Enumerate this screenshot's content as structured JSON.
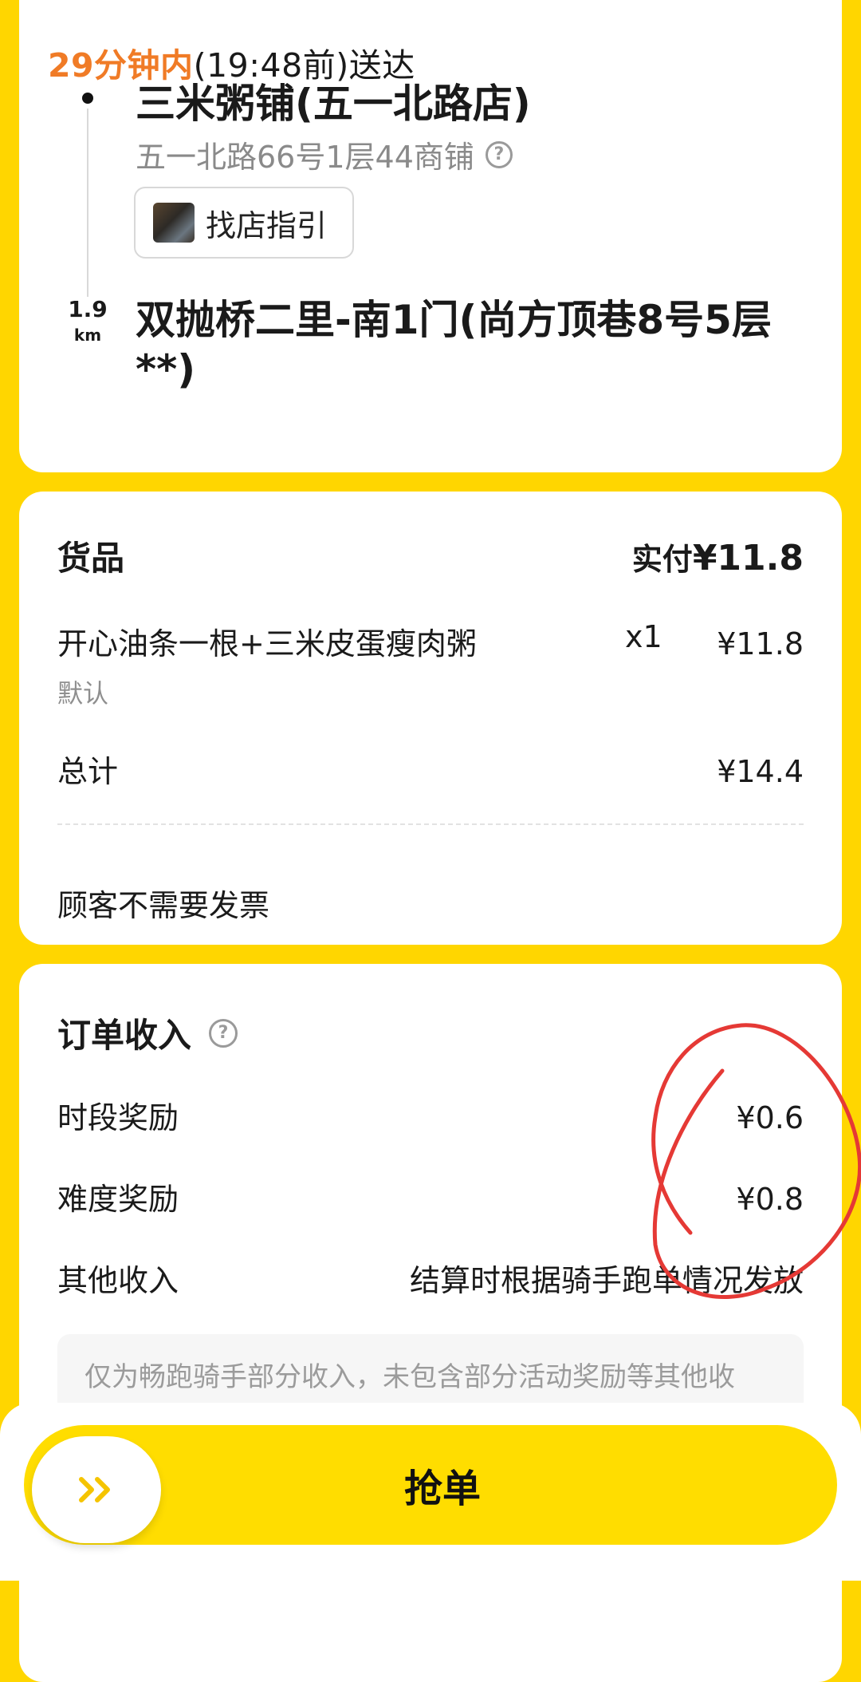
{
  "route": {
    "eta_highlight": "29分钟内",
    "eta_rest": "(19:48前)送达",
    "shop_name": "三米粥铺(五一北路店)",
    "shop_address": "五一北路66号1层44商铺",
    "guide_label": "找店指引",
    "distance_value": "1.9",
    "distance_unit": "km",
    "destination": "双抛桥二里-南1门(尚方顶巷8号5层**)"
  },
  "goods": {
    "title": "货品",
    "paid_label": "实付",
    "paid_amount": "¥11.8",
    "items": [
      {
        "name": "开心油条一根+三米皮蛋瘦肉粥",
        "qty": "x1",
        "price": "¥11.8",
        "spec": "默认"
      }
    ],
    "total_label": "总计",
    "total_value": "¥14.4",
    "invoice_note": "顾客不需要发票"
  },
  "income": {
    "title": "订单收入",
    "rows": [
      {
        "label": "时段奖励",
        "value": "¥0.6"
      },
      {
        "label": "难度奖励",
        "value": "¥0.8"
      },
      {
        "label": "其他收入",
        "value": "结算时根据骑手跑单情况发放"
      }
    ],
    "note": "仅为畅跑骑手部分收入，未包含部分活动奖励等其他收"
  },
  "action": {
    "grab_label": "抢单",
    "slider_icon": "double-chevron-right-icon"
  },
  "colors": {
    "accent_yellow": "#FFDD00",
    "eta_orange": "#F07B26",
    "annotation_red": "#E53935"
  }
}
